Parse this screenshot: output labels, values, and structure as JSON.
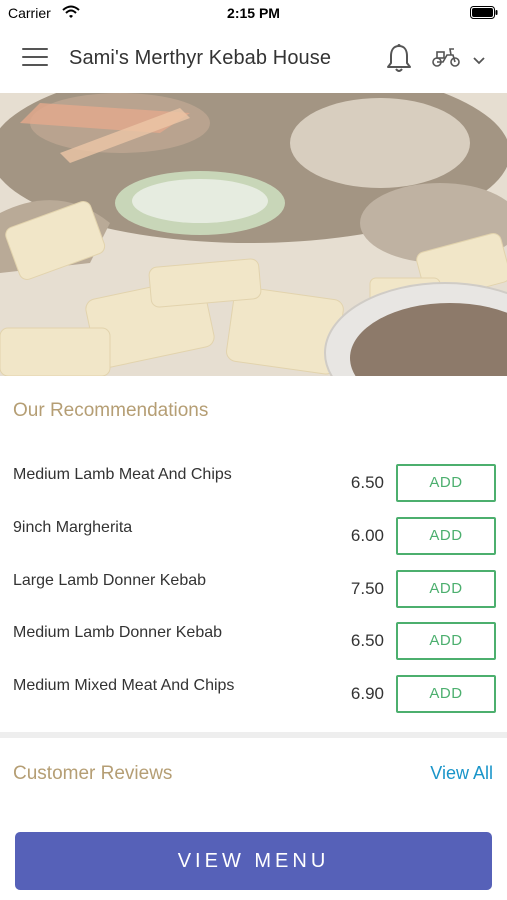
{
  "status_bar": {
    "carrier": "Carrier",
    "time": "2:15 PM"
  },
  "header": {
    "title": "Sami's Merthyr Kebab House",
    "icons": [
      "menu-icon",
      "bell-icon",
      "scooter-icon",
      "chevron-down-icon"
    ]
  },
  "recommendations": {
    "title": "Our Recommendations",
    "items": [
      {
        "name": "Medium Lamb Meat And Chips",
        "price": "6.50",
        "button": "ADD"
      },
      {
        "name": "9inch Margherita",
        "price": "6.00",
        "button": "ADD"
      },
      {
        "name": "Large Lamb Donner Kebab",
        "price": "7.50",
        "button": "ADD"
      },
      {
        "name": "Medium Lamb Donner Kebab",
        "price": "6.50",
        "button": "ADD"
      },
      {
        "name": "Medium Mixed Meat And Chips",
        "price": "6.90",
        "button": "ADD"
      }
    ]
  },
  "reviews": {
    "title": "Customer Reviews",
    "view_all": "View All"
  },
  "footer": {
    "view_menu": "VIEW MENU"
  },
  "colors": {
    "accent_gold": "#b59e74",
    "add_green": "#4caf6e",
    "link_blue": "#1a95c9",
    "button_purple": "#5661b8"
  }
}
